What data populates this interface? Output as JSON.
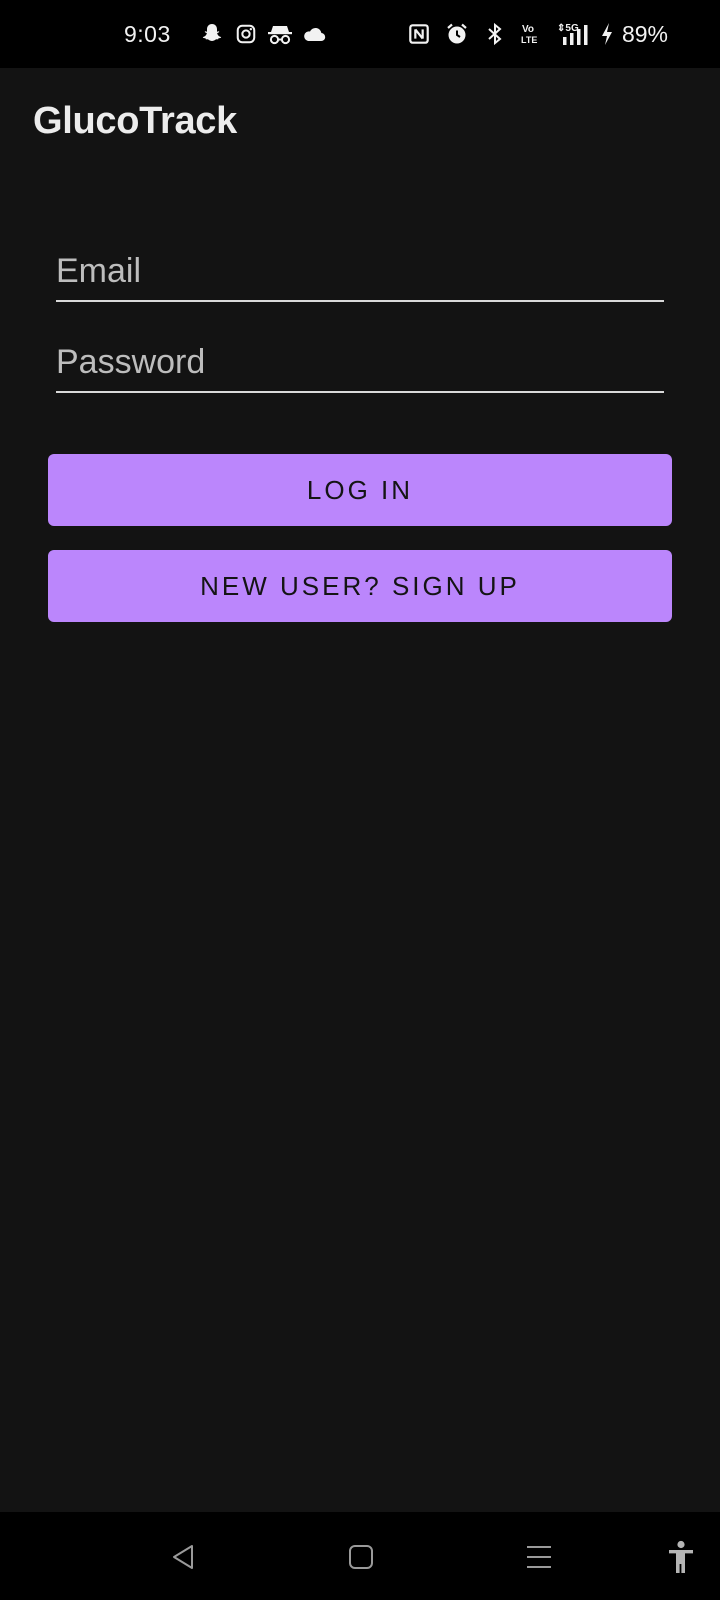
{
  "status_bar": {
    "time": "9:03",
    "left_icons": [
      "snapchat-icon",
      "instagram-icon",
      "incognito-icon",
      "cloud-icon"
    ],
    "right_icons": [
      "nfc-icon",
      "alarm-icon",
      "bluetooth-icon",
      "volte-icon",
      "5g-signal-icon",
      "charging-icon"
    ],
    "battery": "89%"
  },
  "app": {
    "title": "GlucoTrack"
  },
  "form": {
    "email_placeholder": "Email",
    "email_value": "",
    "password_placeholder": "Password",
    "password_value": "",
    "login_label": "LOG IN",
    "signup_label": "NEW USER? SIGN UP"
  },
  "nav_bar": {
    "buttons": [
      "back-icon",
      "home-icon",
      "recents-icon",
      "accessibility-icon"
    ]
  },
  "colors": {
    "background": "#131313",
    "accent": "#bb86fc",
    "system_bars": "#000000"
  }
}
